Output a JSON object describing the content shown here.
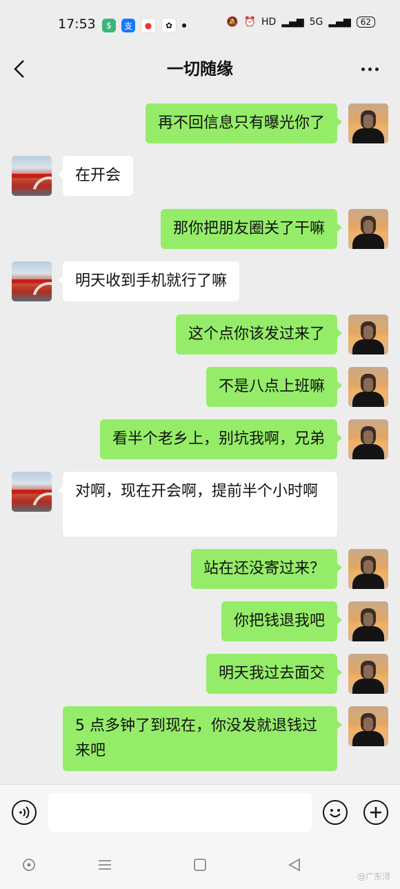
{
  "status_bar": {
    "time": "17:53",
    "indicators": "HD",
    "network_1": "⁴⁶",
    "network_2": "5G",
    "battery": "62"
  },
  "header": {
    "title": "一切随缘",
    "back_icon": "chevron-left-icon",
    "more_icon": "more-dots-icon"
  },
  "messages": [
    {
      "sender": "me",
      "text": "再不回信息只有曝光你了"
    },
    {
      "sender": "them",
      "text": "在开会"
    },
    {
      "sender": "me",
      "text": "那你把朋友圈关了干嘛"
    },
    {
      "sender": "them",
      "text": "明天收到手机就行了嘛"
    },
    {
      "sender": "me",
      "text": "这个点你该发过来了"
    },
    {
      "sender": "me",
      "text": "不是八点上班嘛"
    },
    {
      "sender": "me",
      "text": "看半个老乡上，别坑我啊，兄弟"
    },
    {
      "sender": "them",
      "text": "对啊，现在开会啊，提前半个小时啊"
    },
    {
      "sender": "me",
      "text": "站在还没寄过来？"
    },
    {
      "sender": "me",
      "text": "你把钱退我吧"
    },
    {
      "sender": "me",
      "text": "明天我过去面交"
    },
    {
      "sender": "me",
      "text": "5 点多钟了到现在，你没发就退钱过来吧"
    }
  ],
  "input_bar": {
    "voice_icon": "voice-icon",
    "emoji_icon": "emoji-icon",
    "plus_icon": "plus-icon",
    "text_value": ""
  },
  "nav_bar": {
    "icons": [
      "home-dot-icon",
      "menu-icon",
      "square-icon",
      "back-triangle-icon"
    ]
  },
  "watermark": "@广东浔",
  "colors": {
    "background": "#ededed",
    "my_bubble": "#95ec69",
    "their_bubble": "#ffffff"
  }
}
